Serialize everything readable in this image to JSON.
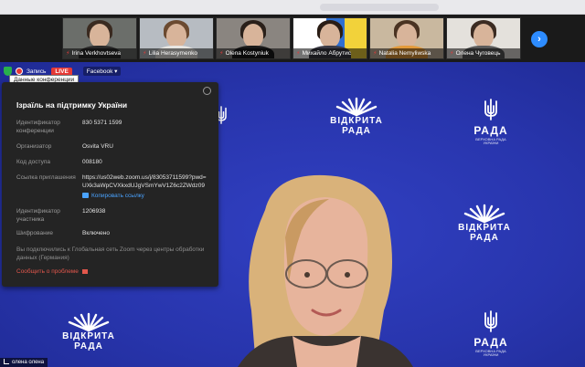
{
  "participants": [
    {
      "name": "Irina Verkhovtseva"
    },
    {
      "name": "Lilia Herasymenko"
    },
    {
      "name": "Olena Kostyniuk"
    },
    {
      "name": "Михайло Абрутис"
    },
    {
      "name": "Natalia Nemyliwska"
    },
    {
      "name": "Олена Чуговець"
    }
  ],
  "toolbar": {
    "record_label": "Запись",
    "live_label": "LIVE",
    "facebook_label": "Facebook ▾",
    "tooltip": "Данные конференции"
  },
  "info": {
    "title": "Ізраїль на підтримку України",
    "rows": [
      {
        "key": "Идентификатор конференции",
        "value": "830 5371 1599"
      },
      {
        "key": "Организатор",
        "value": "Osvita VRU"
      },
      {
        "key": "Код доступа",
        "value": "008180"
      },
      {
        "key": "Ссылка приглашения",
        "value": "https://us02web.zoom.us/j/83053711599?pwd=UXk3aWpCVXkxdUJgVSmYwV1Z6c2ZWdz09"
      },
      {
        "key": "Идентификатор участника",
        "value": "1206938"
      },
      {
        "key": "Шифрование",
        "value": "Включено"
      }
    ],
    "copy_link": "Копировать ссылку",
    "note": "Вы подключились к Глобальная сеть Zoom через центры обработки данных (Германия)",
    "report": "Сообщить о проблеме"
  },
  "logos": {
    "sun_line1": "ВІДКРИТА",
    "sun_line2": "РАДА",
    "trz_line1": "РАДА",
    "trz_line2": "ВЕРХОВНА РАДА УКРАЇНИ"
  },
  "self_name": "олена олена",
  "colors": {
    "stage": "#2633a6",
    "accent": "#2d8cff",
    "live": "#e53935",
    "panel": "#242424"
  }
}
